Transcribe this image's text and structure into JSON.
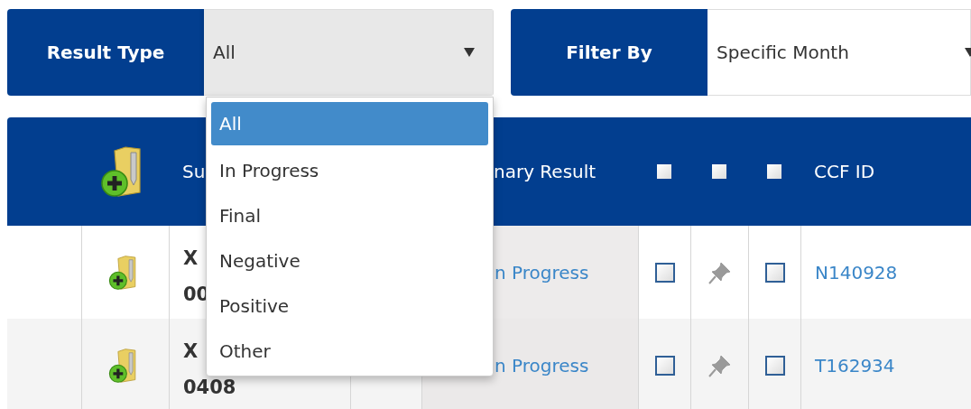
{
  "filters": [
    {
      "label": "Result Type",
      "value": "All",
      "open": true
    },
    {
      "label": "Filter By",
      "value": "Specific Month",
      "open": false
    }
  ],
  "dropdown": {
    "options": [
      {
        "label": "All",
        "selected": true
      },
      {
        "label": "In Progress",
        "selected": false
      },
      {
        "label": "Final",
        "selected": false
      },
      {
        "label": "Negative",
        "selected": false
      },
      {
        "label": "Positive",
        "selected": false
      },
      {
        "label": "Other",
        "selected": false
      }
    ]
  },
  "table": {
    "columns": [
      {
        "kind": "empty"
      },
      {
        "kind": "icon"
      },
      {
        "kind": "text",
        "label": "Su"
      },
      {
        "kind": "empty"
      },
      {
        "kind": "text",
        "label": "nary Result"
      },
      {
        "kind": "checkbox",
        "checked": false
      },
      {
        "kind": "checkbox",
        "checked": false
      },
      {
        "kind": "checkbox",
        "checked": false
      },
      {
        "kind": "text",
        "label": "CCF ID"
      }
    ],
    "rows": [
      {
        "subject_line_1": "X",
        "subject_line_2": "00",
        "status": "n Progress",
        "checked": false,
        "pinned": false,
        "flagged": false,
        "ccf_id": "N140928"
      },
      {
        "subject_line_1": "X",
        "subject_line_2": "0408",
        "status": "n Progress",
        "checked": false,
        "pinned": false,
        "flagged": false,
        "ccf_id": "T162934"
      }
    ]
  }
}
